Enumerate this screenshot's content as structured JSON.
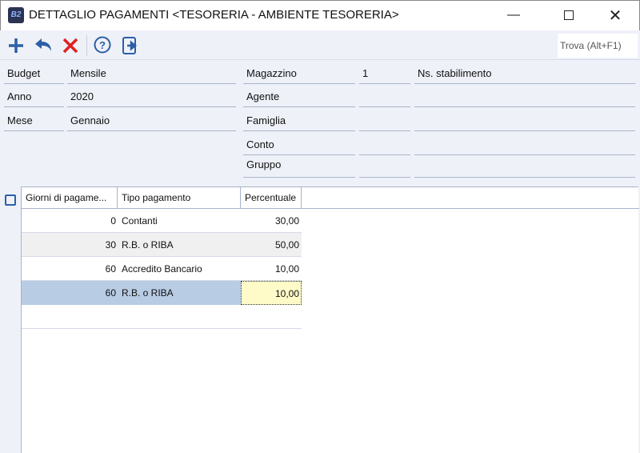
{
  "window": {
    "title": "DETTAGLIO PAGAMENTI <TESORERIA - AMBIENTE TESORERIA>",
    "app_icon_text": "B2"
  },
  "toolbar": {
    "find_label": "Trova (Alt+F1)"
  },
  "fields": {
    "budget": {
      "label": "Budget",
      "value": "Mensile"
    },
    "anno": {
      "label": "Anno",
      "value": "2020"
    },
    "mese": {
      "label": "Mese",
      "value": "Gennaio"
    },
    "magazzino": {
      "label": "Magazzino",
      "code": "1",
      "desc": "Ns. stabilimento"
    },
    "agente": {
      "label": "Agente"
    },
    "famiglia": {
      "label": "Famiglia"
    },
    "conto": {
      "label": "Conto"
    },
    "gruppo": {
      "label": "Gruppo"
    }
  },
  "grid": {
    "headers": [
      "Giorni di pagame...",
      "Tipo pagamento",
      "Percentuale"
    ],
    "rows": [
      {
        "giorni": "0",
        "tipo": "Contanti",
        "perc": "30,00"
      },
      {
        "giorni": "30",
        "tipo": "R.B. o RIBA",
        "perc": "50,00"
      },
      {
        "giorni": "60",
        "tipo": "Accredito Bancario",
        "perc": "10,00"
      },
      {
        "giorni": "60",
        "tipo": "R.B. o RIBA",
        "perc": "10,00"
      }
    ]
  },
  "colors": {
    "accent": "#2d5fa8",
    "delete": "#e02020",
    "selected_row": "#b8cce4",
    "active_cell": "#fffbc8"
  }
}
